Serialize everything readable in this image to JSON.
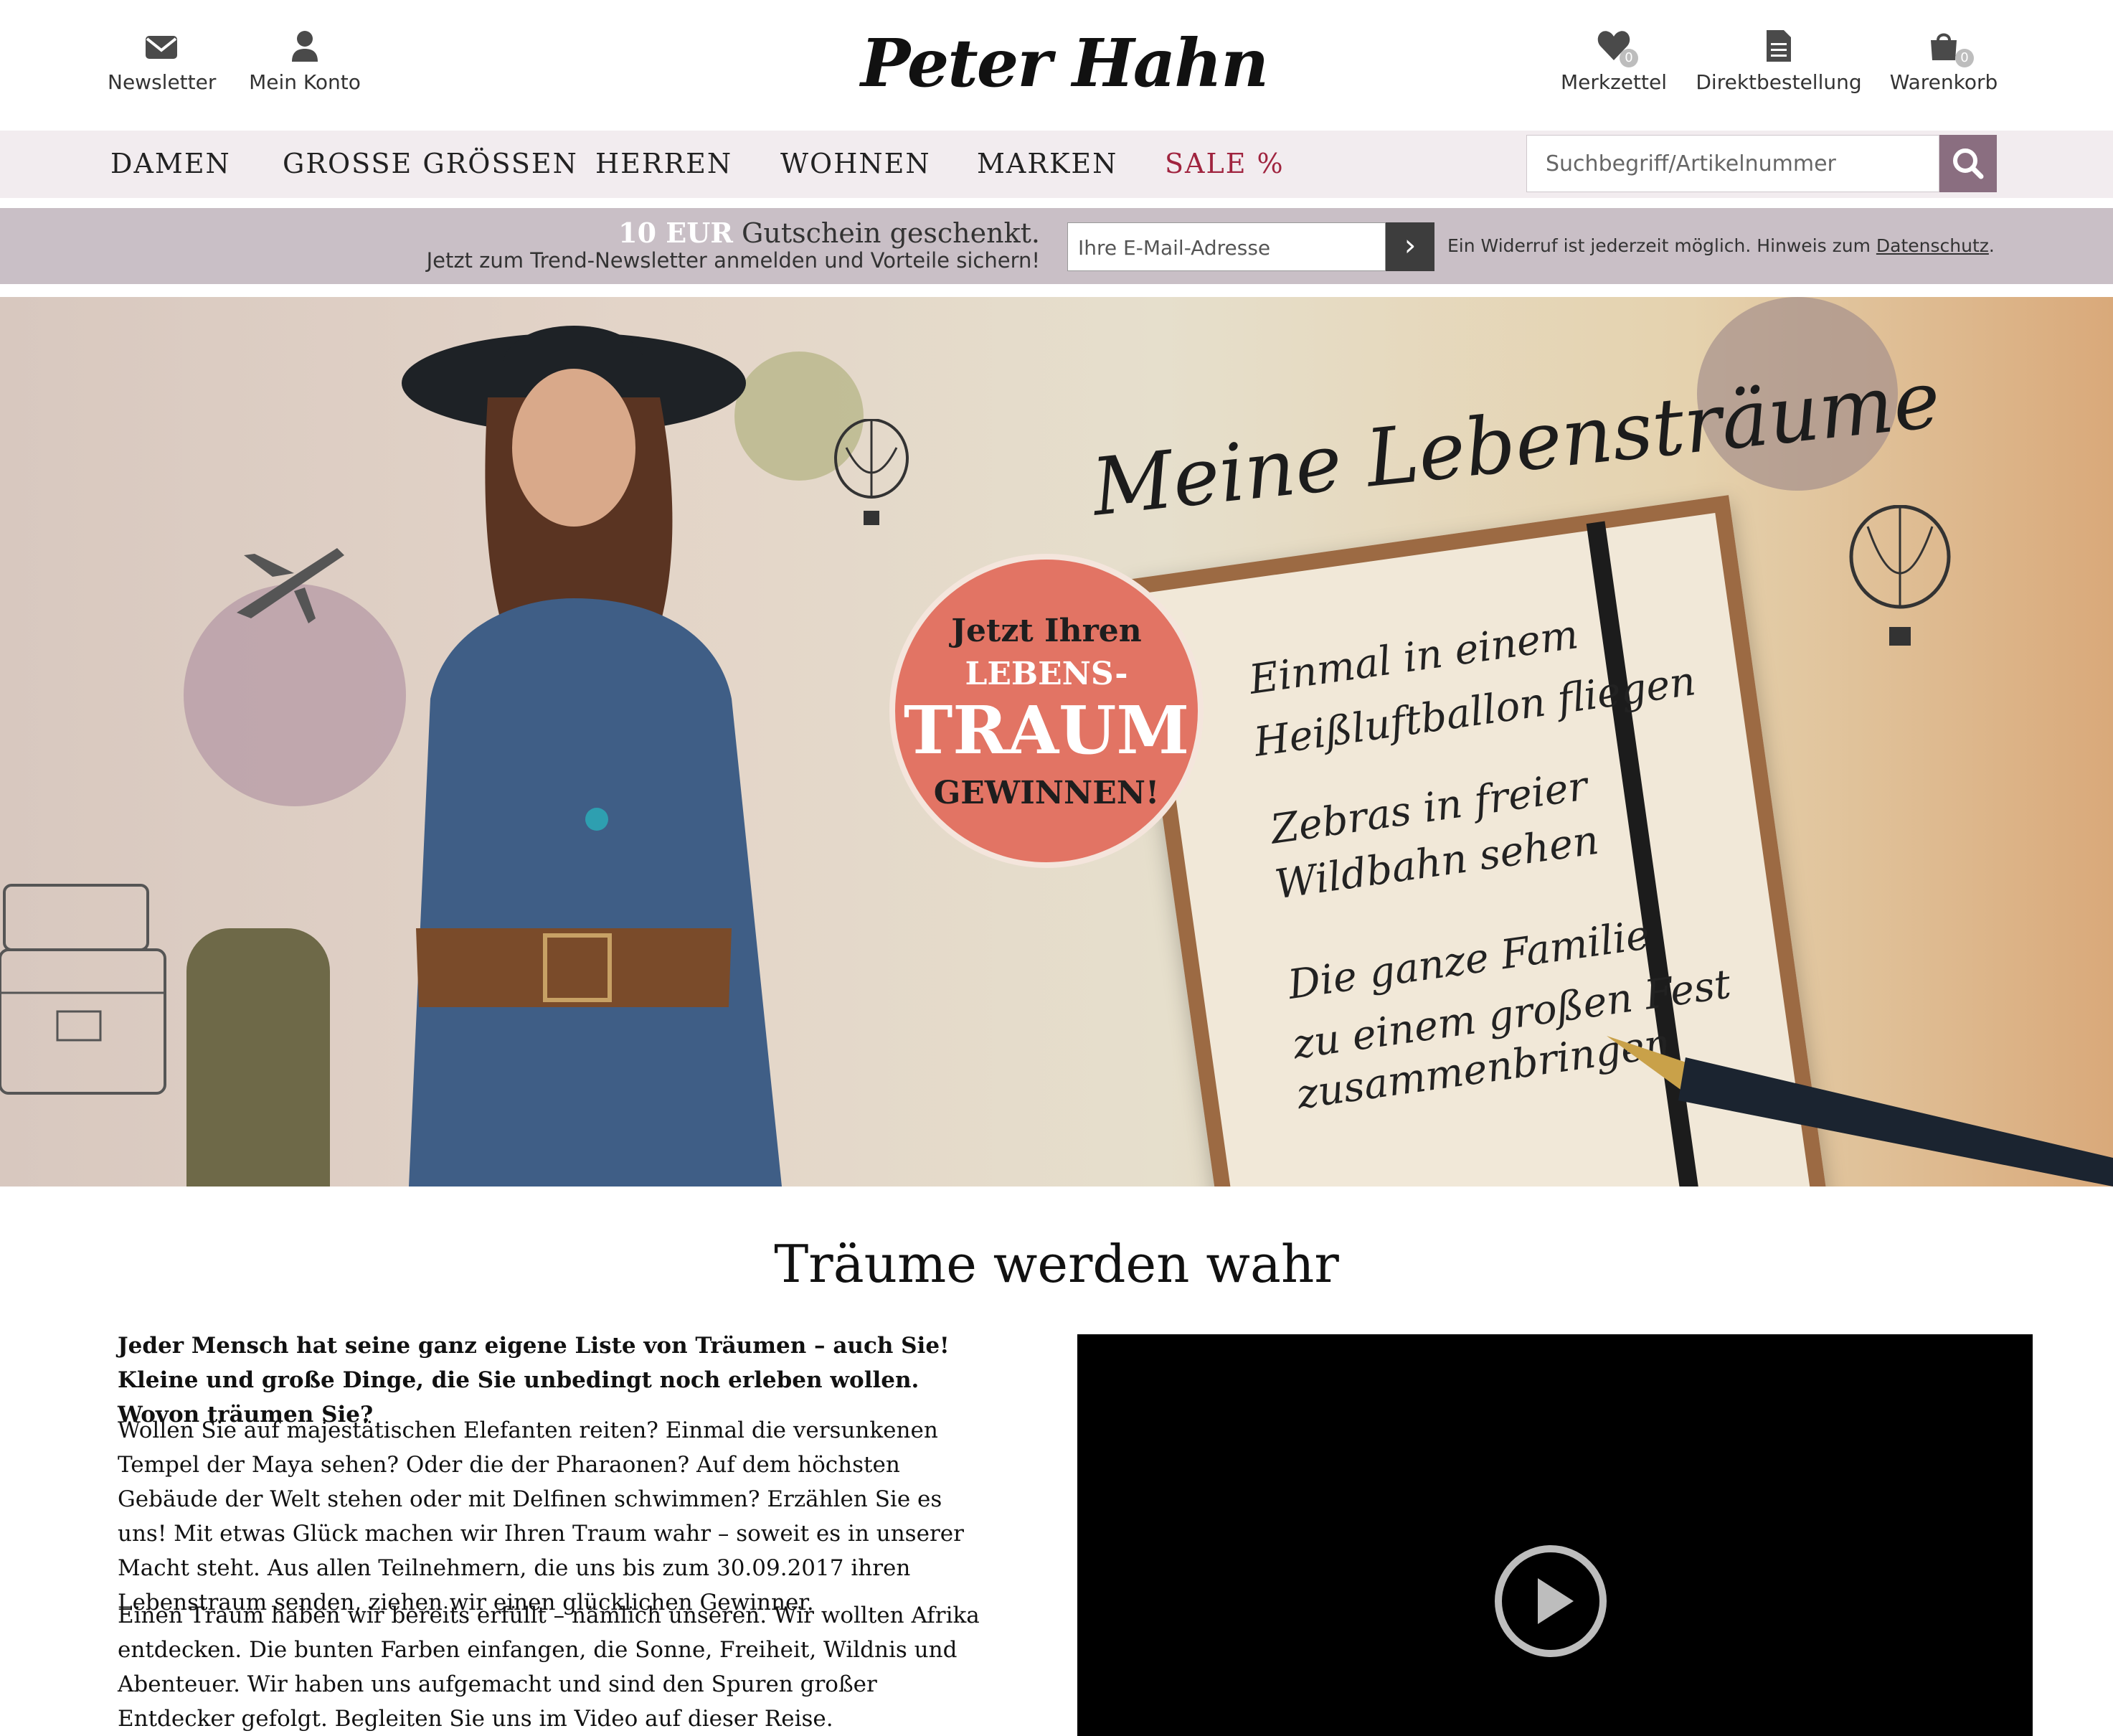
{
  "header": {
    "left_links": [
      {
        "label": "Newsletter",
        "icon": "envelope-icon"
      },
      {
        "label": "Mein Konto",
        "icon": "user-icon"
      }
    ],
    "logo_text": "Peter Hahn",
    "right_links": [
      {
        "label": "Merkzettel",
        "icon": "heart-icon",
        "count": "0"
      },
      {
        "label": "Direktbestellung",
        "icon": "document-icon"
      },
      {
        "label": "Warenkorb",
        "icon": "shopping-bag-icon",
        "count": "0"
      }
    ]
  },
  "nav": {
    "items": [
      "DAMEN",
      "GROSSE GRÖSSEN",
      "HERREN",
      "WOHNEN",
      "MARKEN",
      "SALE %"
    ],
    "search_placeholder": "Suchbegriff/Artikelnummer"
  },
  "newsletter": {
    "amount": "10 EUR",
    "headline": "Gutschein geschenkt.",
    "subline": "Jetzt zum Trend-Newsletter anmelden und Vorteile sichern!",
    "email_placeholder": "Ihre E-Mail-Adresse",
    "submit_glyph": "›",
    "notice": "Ein Widerruf ist jederzeit möglich. Hinweis zum",
    "notice_link": "Datenschutz",
    "notice_end": "."
  },
  "hero": {
    "title": "Meine Lebensträume",
    "badge": {
      "line1": "Jetzt Ihren",
      "line2": "LEBENS-",
      "line3": "TRAUM",
      "line4": "GEWINNEN!"
    },
    "dreams": [
      "Einmal in einem",
      "Heißluftballon fliegen",
      "Zebras in freier",
      "Wildbahn sehen",
      "Die ganze Familie",
      "zu einem großen Fest",
      "zusammenbringen"
    ]
  },
  "content": {
    "heading": "Träume werden wahr",
    "intro": "Jeder Mensch hat seine ganz eigene Liste von Träumen – auch Sie! Kleine und große Dinge, die Sie unbedingt noch erleben wollen. Wovon träumen Sie?",
    "para1": "Wollen Sie auf majestätischen Elefanten reiten? Einmal die versunkenen Tempel der Maya sehen? Oder die der Pharaonen? Auf dem höchsten Gebäude der Welt stehen oder mit Delfinen schwimmen? Erzählen Sie es uns! Mit etwas Glück machen wir Ihren Traum wahr – soweit es in unserer Macht steht. Aus allen Teilnehmern, die uns bis zum 30.09.2017 ihren Lebenstraum senden, ziehen wir einen glücklichen Gewinner.",
    "para2": "Einen Traum haben wir bereits erfüllt – nämlich unseren. Wir wollten Afrika entdecken. Die bunten Farben einfangen, die Sonne, Freiheit, Wildnis und Abenteuer. Wir haben uns aufgemacht und sind den Spuren großer Entdecker gefolgt. Begleiten Sie uns im Video auf dieser Reise."
  },
  "colors": {
    "nav_bg": "#f2ecef",
    "newsletter_bg": "#c9bfc6",
    "search_button": "#8a6e80",
    "sale": "#a0243f",
    "badge": "#e27464"
  }
}
